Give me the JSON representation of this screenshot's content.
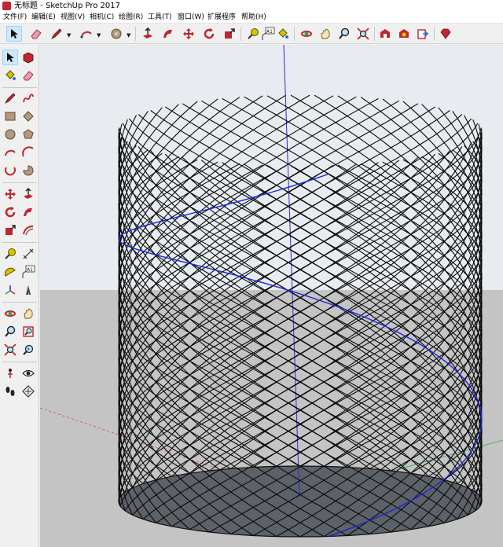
{
  "window": {
    "title": "无标题 - SketchUp Pro 2017"
  },
  "menubar": {
    "items": [
      {
        "label": "文件(F)"
      },
      {
        "label": "编辑(E)"
      },
      {
        "label": "视图(V)"
      },
      {
        "label": "相机(C)"
      },
      {
        "label": "绘图(R)"
      },
      {
        "label": "工具(T)"
      },
      {
        "label": "窗口(W)"
      },
      {
        "label": "扩展程序"
      },
      {
        "label": "帮助(H)"
      }
    ]
  },
  "toolbar": {
    "tools": [
      {
        "icon": "select-arrow-icon",
        "selected": true
      },
      {
        "icon": "eraser-icon"
      },
      {
        "icon": "pencil-icon",
        "dropdown": true
      },
      {
        "icon": "arc-icon",
        "dropdown": true
      },
      {
        "icon": "shape-circle-icon",
        "dropdown": true
      },
      {
        "icon": "push-pull-icon"
      },
      {
        "icon": "follow-me-icon"
      },
      {
        "icon": "move-icon"
      },
      {
        "icon": "rotate-icon"
      },
      {
        "icon": "scale-icon"
      },
      {
        "icon": "tape-measure-icon"
      },
      {
        "icon": "text-label-icon"
      },
      {
        "icon": "paint-bucket-icon"
      },
      {
        "icon": "orbit-icon"
      },
      {
        "icon": "pan-icon"
      },
      {
        "icon": "zoom-icon"
      },
      {
        "icon": "zoom-extents-icon"
      },
      {
        "icon": "warehouse-icon"
      },
      {
        "icon": "extension-warehouse-icon"
      },
      {
        "icon": "send-to-layout-icon"
      },
      {
        "icon": "ruby-extension-icon"
      }
    ],
    "text_tool_label": "A1"
  },
  "sidebar": {
    "tools": [
      {
        "icon": "select-arrow-icon",
        "selected": true
      },
      {
        "icon": "make-component-icon"
      },
      {
        "icon": "paint-bucket-icon"
      },
      {
        "icon": "eraser-icon"
      },
      {
        "icon": "pencil-icon"
      },
      {
        "icon": "freehand-icon"
      },
      {
        "icon": "rectangle-icon"
      },
      {
        "icon": "rotated-rectangle-icon"
      },
      {
        "icon": "circle-icon"
      },
      {
        "icon": "polygon-icon"
      },
      {
        "icon": "arc-icon"
      },
      {
        "icon": "two-point-arc-icon"
      },
      {
        "icon": "three-point-arc-icon"
      },
      {
        "icon": "pie-icon"
      },
      {
        "icon": "move-icon"
      },
      {
        "icon": "push-pull-icon"
      },
      {
        "icon": "rotate-icon"
      },
      {
        "icon": "follow-me-icon"
      },
      {
        "icon": "scale-icon"
      },
      {
        "icon": "offset-icon"
      },
      {
        "icon": "tape-measure-icon"
      },
      {
        "icon": "dimension-icon"
      },
      {
        "icon": "protractor-icon"
      },
      {
        "icon": "text-label-icon"
      },
      {
        "icon": "axes-icon"
      },
      {
        "icon": "3d-text-icon"
      },
      {
        "icon": "orbit-icon"
      },
      {
        "icon": "pan-icon"
      },
      {
        "icon": "zoom-icon"
      },
      {
        "icon": "zoom-window-icon"
      },
      {
        "icon": "zoom-extents-icon"
      },
      {
        "icon": "previous-view-icon"
      },
      {
        "icon": "position-camera-icon"
      },
      {
        "icon": "look-around-icon"
      },
      {
        "icon": "walk-icon"
      },
      {
        "icon": "section-plane-icon"
      }
    ],
    "text_tool_label": "A1"
  },
  "viewport": {
    "model": "helical cylinder lattice",
    "colors": {
      "sky": "#e8ecf0",
      "ground": "#c4c4c4",
      "lattice": "#0a0a0a",
      "helix": "#1a25d8",
      "base_fill": "#5d6168",
      "axis_green": "#2fa84a",
      "axis_red": "#d44a4a",
      "axis_blue": "#2a2ad8"
    }
  }
}
